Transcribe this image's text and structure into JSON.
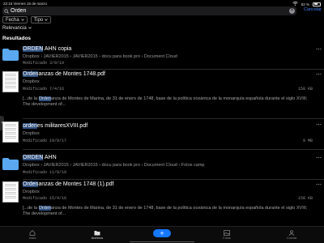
{
  "status": {
    "time_date": "22:16   Viernes 15 de marzo",
    "battery_pct": "62 %"
  },
  "search": {
    "value": "Orden",
    "cancel_label": "Cancelar"
  },
  "filters": [
    {
      "label": "Fecha"
    },
    {
      "label": "Tipo"
    }
  ],
  "sort": {
    "label": "Relevancia"
  },
  "results_heading": "Resultados",
  "results": [
    {
      "type": "folder",
      "title_hl": "ORDEN",
      "title_rest": " AHN copia",
      "location": "Dropbox › JAVIER2015 › JAVIER2015 › docu para book pro › Document Cloud",
      "modified": "Modificado 3/9/19"
    },
    {
      "type": "pdf",
      "title_hl": "Orden",
      "title_rest": "anzas de Montes 1748.pdf",
      "location": "Dropbox",
      "modified": "Modificado 7/4/16",
      "size": "158 KB",
      "snippet_pre": "[...de la ",
      "snippet_hl": "Orden",
      "snippet_post": "anza de Montes de Marina, de 31 de enero de 1748, base de la política oceánica de la monarquía española durante el siglo XVIII; The development of..."
    },
    {
      "type": "pdf",
      "title_hl": "orden",
      "title_rest": "es militaresXVIII.pdf",
      "location": "Dropbox",
      "modified": "Modificado 19/9/17",
      "size": "9 MB"
    },
    {
      "type": "folder",
      "title_hl": "ORDEN",
      "title_rest": " AHN",
      "location": "Dropbox › JAVIER2015 › JAVIER2015 › docu para book pro › Document Cloud › Fotos camp",
      "modified": "Modificado 11/9/19"
    },
    {
      "type": "pdf",
      "title_hl": "Orden",
      "title_rest": "anzas de Montes 1748 (1).pdf",
      "location": "Dropbox",
      "modified": "Modificado 15/4/16",
      "size": "158 KB",
      "snippet_pre": "[...de la ",
      "snippet_hl": "Orden",
      "snippet_post": "anza de Montes de Marina, de 31 de enero de 1748, base de la política oceánica de la monarquía española durante el siglo XVIII; The development of..."
    }
  ],
  "tabs": [
    {
      "label": "Inicio",
      "icon": "home-icon"
    },
    {
      "label": "Archivos",
      "icon": "folder-icon"
    },
    {
      "label": "",
      "icon": "plus-icon"
    },
    {
      "label": "Fotos",
      "icon": "photos-icon"
    },
    {
      "label": "Cuenta",
      "icon": "account-icon"
    }
  ],
  "colors": {
    "accent": "#1677ff",
    "folder": "#5aa9f0",
    "highlight": "#2f4f7f"
  }
}
